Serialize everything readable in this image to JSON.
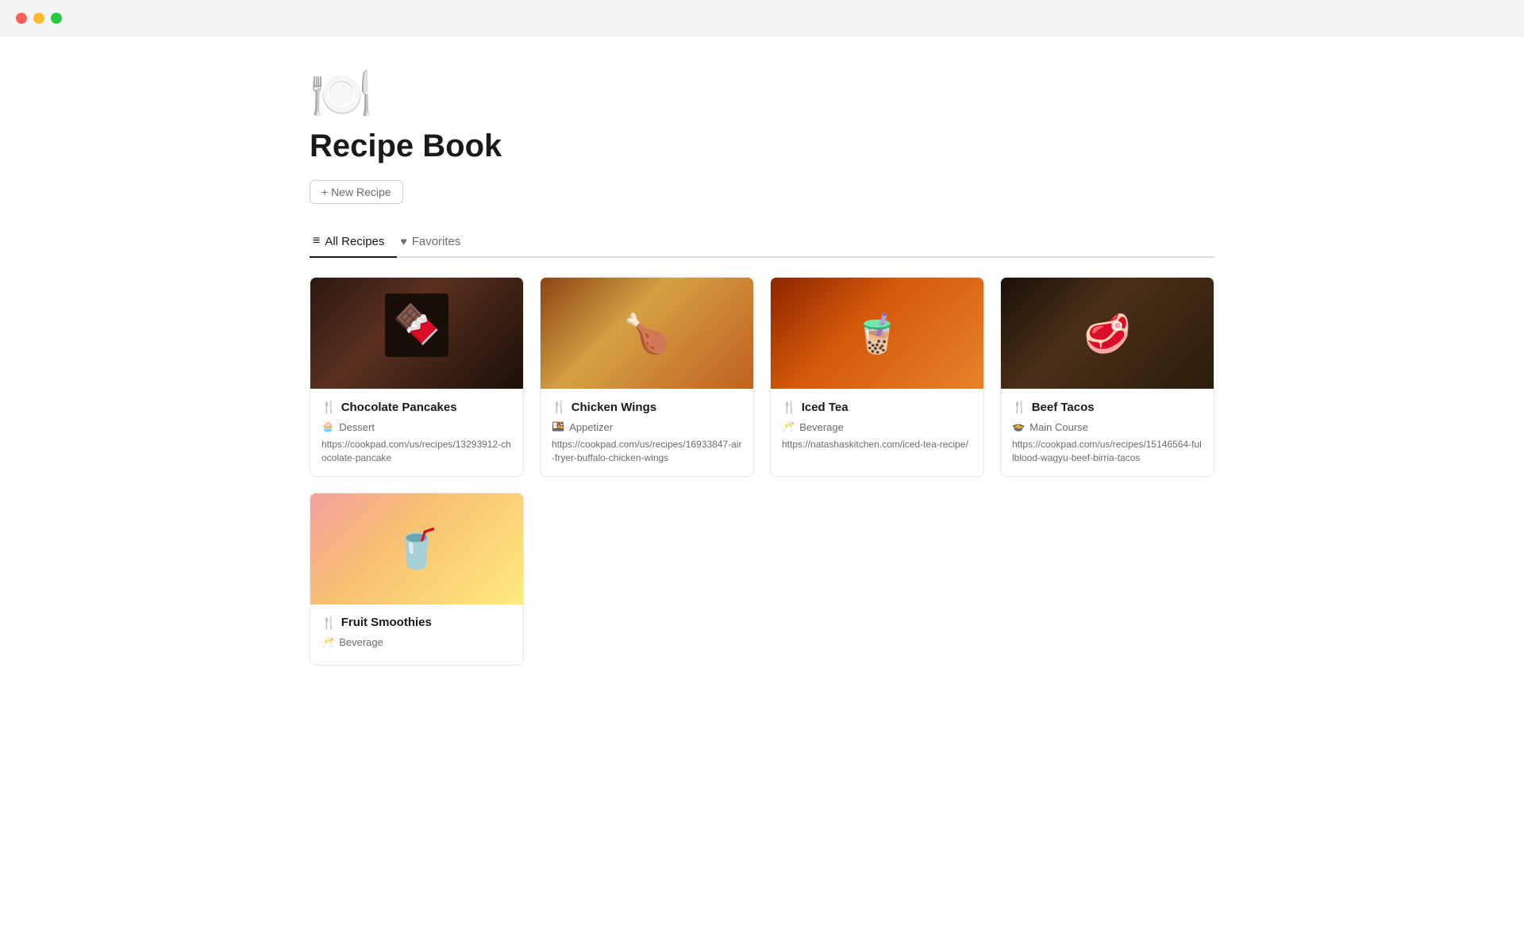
{
  "titlebar": {
    "traffic_lights": [
      {
        "color": "red",
        "label": "close"
      },
      {
        "color": "yellow",
        "label": "minimize"
      },
      {
        "color": "green",
        "label": "maximize"
      }
    ]
  },
  "page": {
    "icon": "🍽️",
    "title": "Recipe Book",
    "new_recipe_label": "+ New Recipe"
  },
  "tabs": [
    {
      "id": "all-recipes",
      "label": "All Recipes",
      "icon": "≡",
      "active": true
    },
    {
      "id": "favorites",
      "label": "Favorites",
      "icon": "♥",
      "active": false
    }
  ],
  "recipes": [
    {
      "id": "chocolate-pancakes",
      "name": "Chocolate Pancakes",
      "icon": "🍴",
      "category_icon": "🧁",
      "category": "Dessert",
      "url": "https://cookpad.com/us/recipes/13293912-chocolate-pancake",
      "image_type": "chocolate"
    },
    {
      "id": "chicken-wings",
      "name": "Chicken Wings",
      "icon": "🍴",
      "category_icon": "🍱",
      "category": "Appetizer",
      "url": "https://cookpad.com/us/recipes/16933847-air-fryer-buffalo-chicken-wings",
      "image_type": "wings"
    },
    {
      "id": "iced-tea",
      "name": "Iced Tea",
      "icon": "🍴",
      "category_icon": "🥂",
      "category": "Beverage",
      "url": "https://natashaskitchen.com/iced-tea-recipe/",
      "image_type": "tea"
    },
    {
      "id": "beef-tacos",
      "name": "Beef Tacos",
      "icon": "🍴",
      "category_icon": "🍲",
      "category": "Main Course",
      "url": "https://cookpad.com/us/recipes/15146564-fullblood-wagyu-beef-birria-tacos",
      "image_type": "tacos"
    },
    {
      "id": "fruit-smoothies",
      "name": "Fruit Smoothies",
      "icon": "🍴",
      "category_icon": "🥂",
      "category": "Beverage",
      "url": "",
      "image_type": "smoothie"
    }
  ]
}
